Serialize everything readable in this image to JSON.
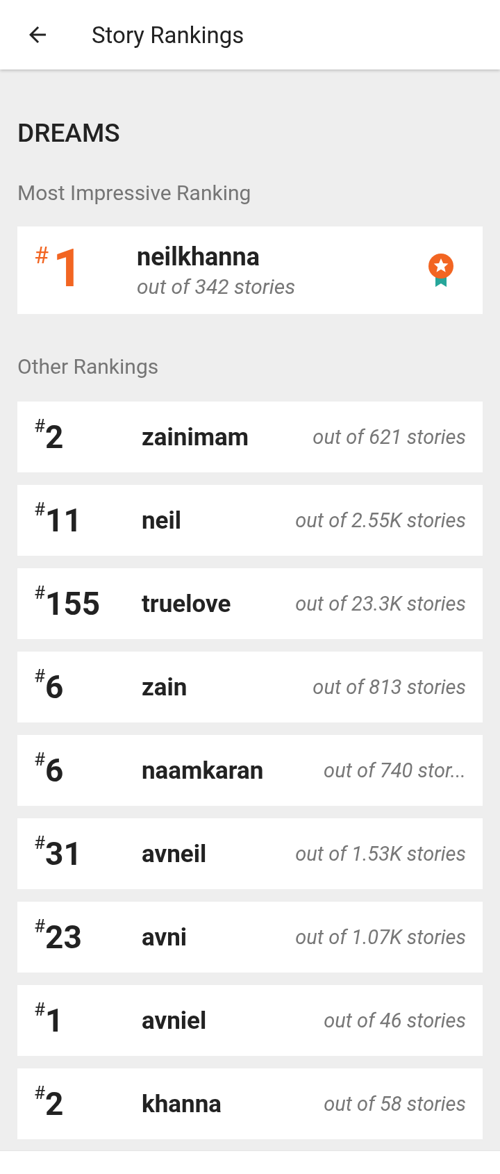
{
  "app_bar": {
    "title": "Story Rankings"
  },
  "story_title": "DREAMS",
  "top_section": {
    "heading": "Most Impressive Ranking",
    "rank": "$^{#}$1",
    "tag": "neilkhanna",
    "count": "out of 342 stories"
  },
  "other_section": {
    "heading": "Other Rankings",
    "rows": [
      {
        "rank": "$^{#}$2",
        "tag": "zainimam",
        "count": "out of 621 stories"
      },
      {
        "rank": "$^{#}$11",
        "tag": "neil",
        "count": "out of 2.55K stories"
      },
      {
        "rank": "$^{#}$155",
        "tag": "truelove",
        "count": "out of 23.3K stories"
      },
      {
        "rank": "$^{#}$6",
        "tag": "zain",
        "count": "out of 813 stories"
      },
      {
        "rank": "$^{#}$6",
        "tag": "naamkaran",
        "count": "out of 740 stor..."
      },
      {
        "rank": "$^{#}$31",
        "tag": "avneil",
        "count": "out of 1.53K stories"
      },
      {
        "rank": "$^{#}$23",
        "tag": "avni",
        "count": "out of 1.07K stories"
      },
      {
        "rank": "$^{#}$1",
        "tag": "avniel",
        "count": "out of 46 stories"
      },
      {
        "rank": "$^{#}$2",
        "tag": "khanna",
        "count": "out of 58 stories"
      }
    ]
  }
}
